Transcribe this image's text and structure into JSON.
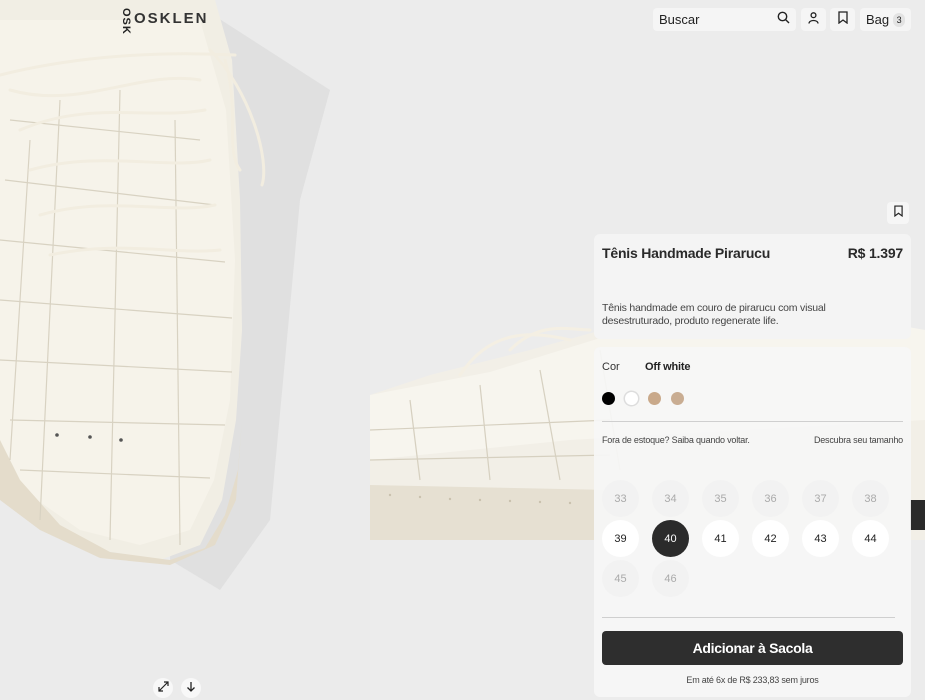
{
  "brand": {
    "logo_text": "OSKLEN",
    "vertical_text": "OSK"
  },
  "header": {
    "search_label": "Buscar",
    "search_icon": "search-icon",
    "account_icon": "user-icon",
    "wishlist_icon": "bookmark-icon",
    "bag_label": "Bag",
    "bag_count": "3"
  },
  "product": {
    "name": "Tênis Handmade Pirarucu",
    "price": "R$ 1.397",
    "description": "Tênis handmade em couro de pirarucu com visual desestruturado, produto regenerate life.",
    "color_label": "Cor",
    "color_value": "Off white",
    "swatches": [
      {
        "name": "black",
        "color": "#000000",
        "selected": false
      },
      {
        "name": "off-white",
        "color": "#ffffff",
        "selected": true
      },
      {
        "name": "tan",
        "color": "#c9a98a",
        "selected": false
      },
      {
        "name": "beige",
        "color": "#c9ad92",
        "selected": false
      }
    ],
    "stock_notice": "Fora de estoque? Saiba quando voltar.",
    "size_guide": "Descubra seu tamanho",
    "sizes": [
      {
        "label": "33",
        "state": "unavailable"
      },
      {
        "label": "34",
        "state": "unavailable"
      },
      {
        "label": "35",
        "state": "unavailable"
      },
      {
        "label": "36",
        "state": "unavailable"
      },
      {
        "label": "37",
        "state": "unavailable"
      },
      {
        "label": "38",
        "state": "unavailable"
      },
      {
        "label": "39",
        "state": "available"
      },
      {
        "label": "40",
        "state": "selected"
      },
      {
        "label": "41",
        "state": "available"
      },
      {
        "label": "42",
        "state": "available"
      },
      {
        "label": "43",
        "state": "available"
      },
      {
        "label": "44",
        "state": "available"
      },
      {
        "label": "45",
        "state": "unavailable"
      },
      {
        "label": "46",
        "state": "unavailable"
      }
    ],
    "add_to_bag": "Adicionar à Sacola",
    "installments": "Em até 6x de R$ 233,83 sem juros"
  },
  "gallery": {
    "expand_icon": "expand-icon",
    "download_icon": "arrow-down-icon"
  },
  "colors": {
    "accent": "#2e2e2e",
    "panel": "#f4f4f4"
  }
}
